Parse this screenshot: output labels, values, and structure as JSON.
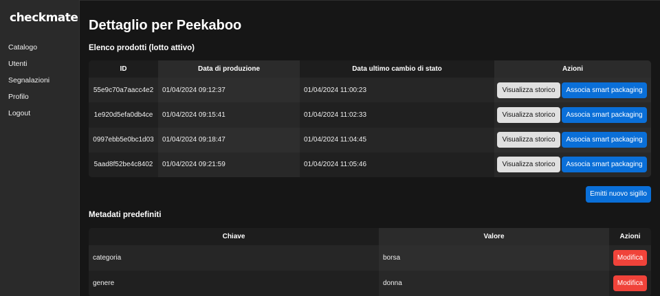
{
  "app": {
    "logo": "checkmate"
  },
  "sidebar": {
    "items": [
      {
        "label": "Catalogo"
      },
      {
        "label": "Utenti"
      },
      {
        "label": "Segnalazioni"
      },
      {
        "label": "Profilo"
      },
      {
        "label": "Logout"
      }
    ]
  },
  "page": {
    "title": "Dettaglio per Peekaboo"
  },
  "products": {
    "section_title": "Elenco prodotti (lotto attivo)",
    "columns": [
      "ID",
      "Data di produzione",
      "Data ultimo cambio di stato",
      "Azioni"
    ],
    "rows": [
      {
        "id": "55e9c70a7aacc4e2",
        "production_date": "01/04/2024 09:12:37",
        "last_change": "01/04/2024 11:00:23"
      },
      {
        "id": "1e920d5efa0db4ce",
        "production_date": "01/04/2024 09:15:41",
        "last_change": "01/04/2024 11:02:33"
      },
      {
        "id": "0997ebb5e0bc1d03",
        "production_date": "01/04/2024 09:18:47",
        "last_change": "01/04/2024 11:04:45"
      },
      {
        "id": "5aad8f52be4c8402",
        "production_date": "01/04/2024 09:21:59",
        "last_change": "01/04/2024 11:05:46"
      }
    ],
    "view_history_label": "Visualizza storico",
    "associate_label": "Associa smart packaging",
    "emit_seal_label": "Emitti nuovo sigillo"
  },
  "metadata": {
    "section_title": "Metadati predefiniti",
    "columns": [
      "Chiave",
      "Valore",
      "Azioni"
    ],
    "rows": [
      {
        "key": "categoria",
        "value": "borsa"
      },
      {
        "key": "genere",
        "value": "donna"
      }
    ],
    "edit_label": "Modifica"
  },
  "colors": {
    "background": "#161616",
    "sidebar": "#2a2a2a",
    "primary_button": "#0a6fd8",
    "secondary_button": "#e0e0e0",
    "danger_button": "#f0433a"
  }
}
